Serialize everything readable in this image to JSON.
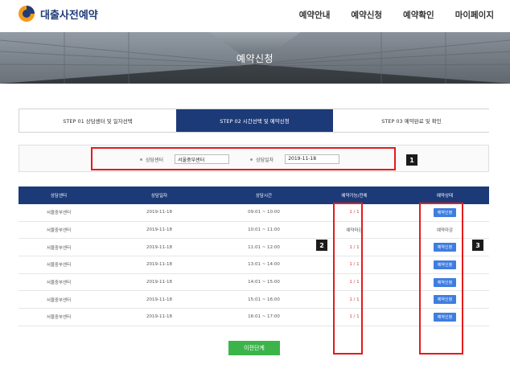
{
  "header": {
    "logo_text": "대출사전예약",
    "nav": [
      "예약안내",
      "예약신청",
      "예약확인",
      "마이페이지"
    ]
  },
  "banner": {
    "title": "예약신청"
  },
  "steps": [
    {
      "label": "STEP 01 상담센터 및 일자선택",
      "active": false
    },
    {
      "label": "STEP 02 시간선택 및 예약신청",
      "active": true
    },
    {
      "label": "STEP 03 예약완료 및 확인",
      "active": false
    }
  ],
  "search": {
    "center_label": "상담센터",
    "center_value": "서울중부센터",
    "date_label": "상담일자",
    "date_value": "2019-11-18"
  },
  "annotations": {
    "badge1": "1",
    "badge2": "2",
    "badge3": "3"
  },
  "table": {
    "headers": [
      "상담센터",
      "상담일자",
      "상담시간",
      "예약가능/전체",
      "예약상태"
    ],
    "rows": [
      {
        "center": "서울중부센터",
        "date": "2019-11-18",
        "time": "09:01 ~ 10:00",
        "avail": "1 / 1",
        "status": "예약신청",
        "closed": false
      },
      {
        "center": "서울중부센터",
        "date": "2019-11-18",
        "time": "10:01 ~ 11:00",
        "avail": "예약마감",
        "status": "예약마감",
        "closed": true
      },
      {
        "center": "서울중부센터",
        "date": "2019-11-18",
        "time": "11:01 ~ 12:00",
        "avail": "1 / 1",
        "status": "예약신청",
        "closed": false
      },
      {
        "center": "서울중부센터",
        "date": "2019-11-18",
        "time": "13:01 ~ 14:00",
        "avail": "1 / 1",
        "status": "예약신청",
        "closed": false
      },
      {
        "center": "서울중부센터",
        "date": "2019-11-18",
        "time": "14:01 ~ 15:00",
        "avail": "1 / 1",
        "status": "예약신청",
        "closed": false
      },
      {
        "center": "서울중부센터",
        "date": "2019-11-18",
        "time": "15:01 ~ 16:00",
        "avail": "1 / 1",
        "status": "예약신청",
        "closed": false
      },
      {
        "center": "서울중부센터",
        "date": "2019-11-18",
        "time": "16:01 ~ 17:00",
        "avail": "1 / 1",
        "status": "예약신청",
        "closed": false
      }
    ]
  },
  "prev_button": "이전단계",
  "colors": {
    "navy": "#1d3a78",
    "button_blue": "#3f7de0",
    "green": "#3bb54a",
    "annotation_red": "#e31b1b"
  }
}
